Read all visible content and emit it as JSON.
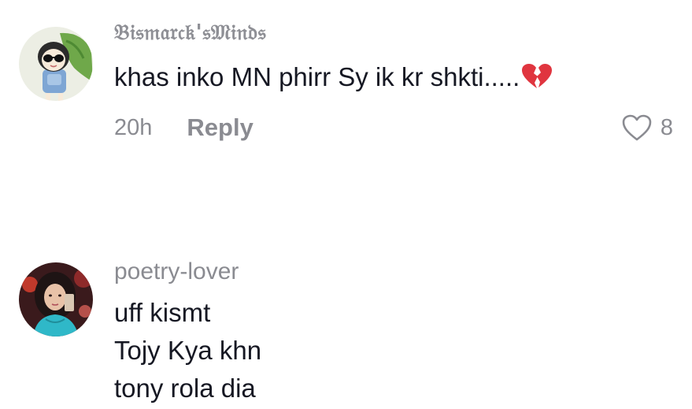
{
  "comments": [
    {
      "username": "𝔅𝔦𝔰𝔪𝔞𝔯𝔠𝔨'𝔰𝔐𝔦𝔫𝔡𝔰",
      "text": "khas inko MN phirr Sy ik kr shkti.....",
      "emoji": "broken-heart-icon",
      "time": "20h",
      "reply_label": "Reply",
      "likes": "8"
    },
    {
      "username": "poetry-lover",
      "lines": [
        "uff kismt",
        "Tojy Kya khn",
        "tony rola dia"
      ]
    }
  ],
  "colors": {
    "text": "#161823",
    "secondary": "#8a8b91",
    "emoji_red": "#e0353f"
  }
}
